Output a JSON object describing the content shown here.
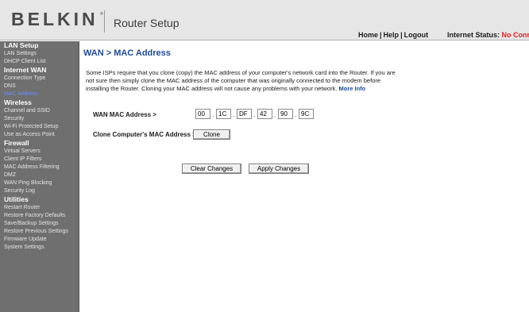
{
  "header": {
    "brand": "BELKIN",
    "brand_mark": "®",
    "title": "Router Setup",
    "links": [
      "Home",
      "Help",
      "Logout"
    ],
    "link_separator": "|",
    "status_label": "Internet Status:",
    "status_value": "No Connection",
    "status_color": "#e32020"
  },
  "sidebar": {
    "sections": [
      {
        "title": "LAN Setup",
        "items": [
          "LAN Settings",
          "DHCP Client List"
        ]
      },
      {
        "title": "Internet WAN",
        "items": [
          "Connection Type",
          "DNS",
          "MAC Address"
        ]
      },
      {
        "title": "Wireless",
        "items": [
          "Channel and SSID",
          "Security",
          "Wi-Fi Protected Setup",
          "Use as Access Point"
        ]
      },
      {
        "title": "Firewall",
        "items": [
          "Virtual Servers",
          "Client IP Filters",
          "MAC Address Filtering",
          "DMZ",
          "WAN Ping Blocking",
          "Security Log"
        ]
      },
      {
        "title": "Utilities",
        "items": [
          "Restart Router",
          "Restore Factory Defaults",
          "Save/Backup Settings",
          "Restore Previous Settings",
          "Firmware Update",
          "System Settings"
        ]
      }
    ],
    "active_item": "MAC Address",
    "active_color": "#6f8cff"
  },
  "main": {
    "title": "WAN > MAC Address",
    "intro": "Some ISPs require that you clone (copy) the MAC address of your computer's network card into the Router. If you are not sure then simply clone the MAC address of the computer that was originally connected to the modem before installing the Router. Cloning your MAC address will not cause any problems with your network.",
    "more_info": "More Info",
    "wan_mac_label": "WAN MAC Address >",
    "mac_octets": [
      "00",
      "1C",
      "DF",
      "42",
      "90",
      "9C"
    ],
    "clone_label": "Clone Computer's MAC Address >",
    "clone_button": "Clone",
    "clear_button": "Clear Changes",
    "apply_button": "Apply Changes"
  }
}
